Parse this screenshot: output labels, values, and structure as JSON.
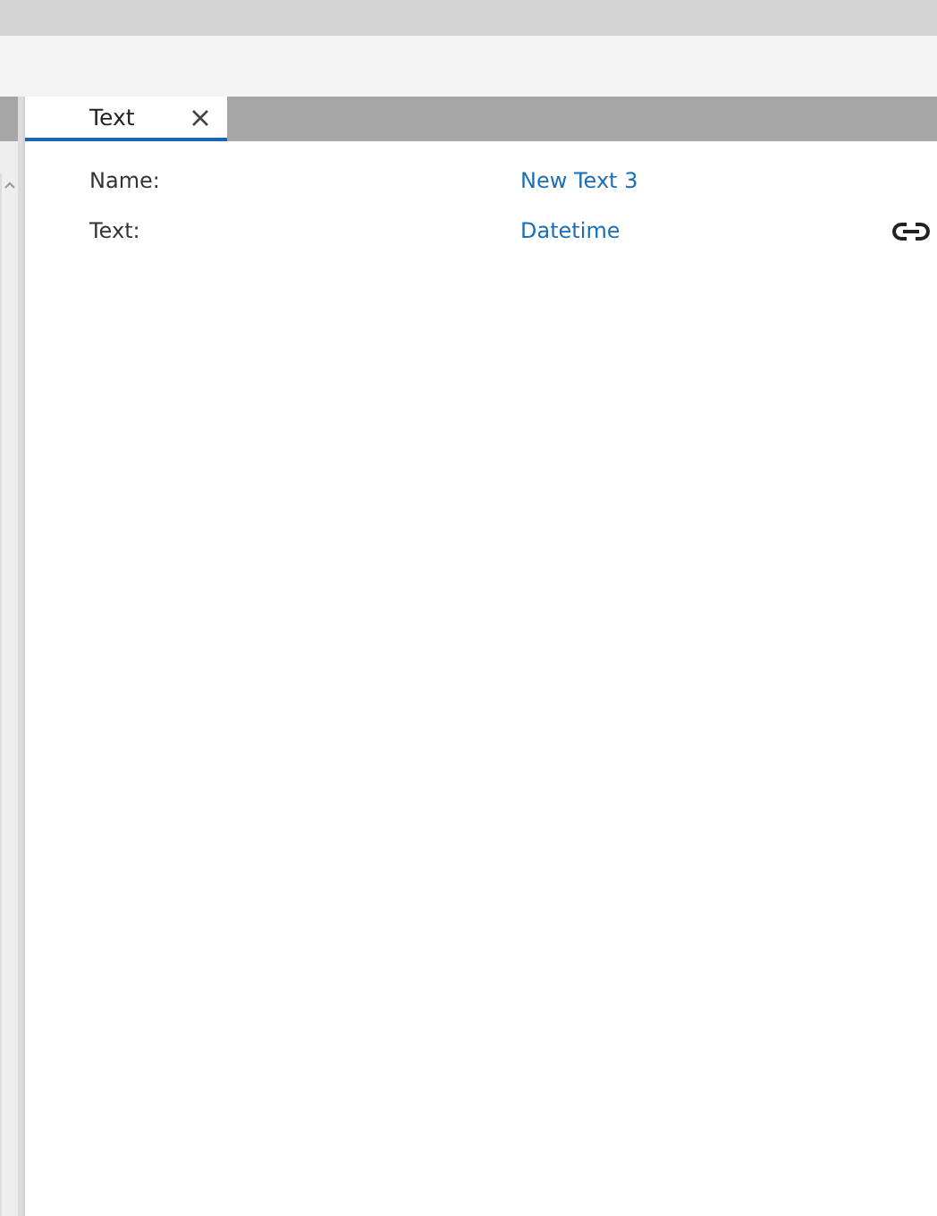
{
  "tabs": [
    {
      "label": "Text",
      "selected": true
    }
  ],
  "properties": [
    {
      "label": "Name:",
      "value": "New Text 3",
      "linked": false
    },
    {
      "label": "Text:",
      "value": "Datetime",
      "linked": true
    }
  ]
}
